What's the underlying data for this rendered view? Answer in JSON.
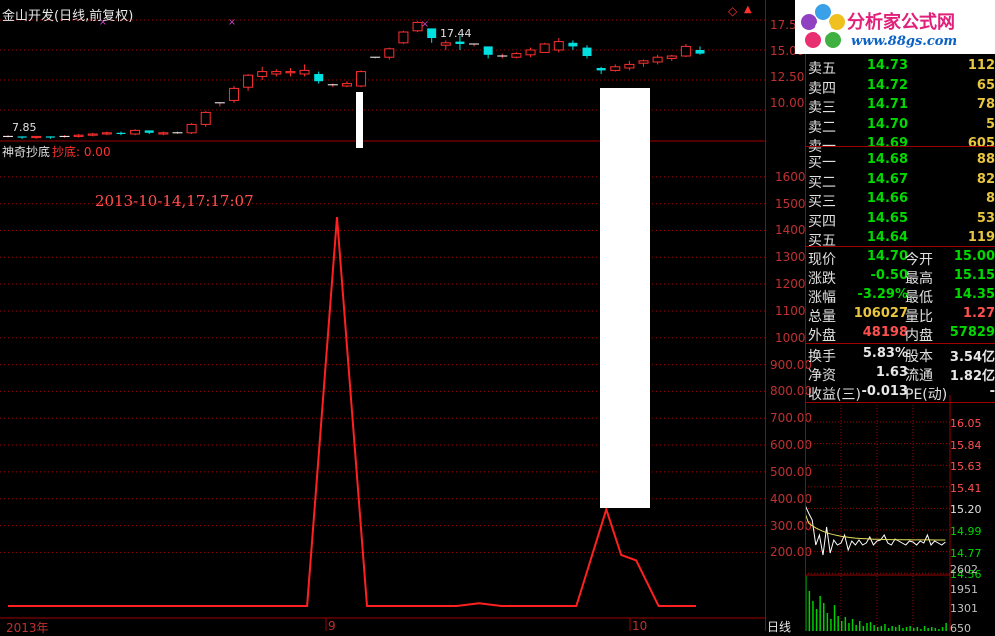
{
  "header": {
    "title": "金山开发(日线,前复权)",
    "indicator_name": "神奇抄底",
    "indicator_label": "抄底: 0.00",
    "timestamp": "2013-10-14,17:17:07",
    "corner_icon": "diamond-icon"
  },
  "price_panel": {
    "ticks": [
      "17.50",
      "15.00",
      "12.50",
      "10.00"
    ],
    "high_label": "17.44",
    "low_label": "7.85"
  },
  "indicator_panel": {
    "ticks": [
      "1600",
      "1500",
      "1400",
      "1300",
      "1200",
      "1100",
      "1000",
      "900.00",
      "800.00",
      "700.00",
      "600.00",
      "500.00",
      "400.00",
      "300.00",
      "200.00"
    ]
  },
  "bottom_axis": {
    "labels": [
      "2013年",
      "9",
      "10"
    ],
    "period": "日线"
  },
  "logo": {
    "title": "分析家公式网",
    "url": "www.88gs.com"
  },
  "quotes": {
    "asks": [
      {
        "label": "卖五",
        "price": "14.73",
        "volume": "112"
      },
      {
        "label": "卖四",
        "price": "14.72",
        "volume": "65"
      },
      {
        "label": "卖三",
        "price": "14.71",
        "volume": "78"
      },
      {
        "label": "卖二",
        "price": "14.70",
        "volume": "5"
      },
      {
        "label": "卖一",
        "price": "14.69",
        "volume": "605"
      }
    ],
    "bids": [
      {
        "label": "买一",
        "price": "14.68",
        "volume": "88"
      },
      {
        "label": "买二",
        "price": "14.67",
        "volume": "82"
      },
      {
        "label": "买三",
        "price": "14.66",
        "volume": "8"
      },
      {
        "label": "买四",
        "price": "14.65",
        "volume": "53"
      },
      {
        "label": "买五",
        "price": "14.64",
        "volume": "119"
      }
    ]
  },
  "stats": [
    {
      "l1": "现价",
      "v1": "14.70",
      "c1": "#00d800",
      "l2": "今开",
      "v2": "15.00",
      "c2": "#00d800"
    },
    {
      "l1": "涨跌",
      "v1": "-0.50",
      "c1": "#00d800",
      "l2": "最高",
      "v2": "15.15",
      "c2": "#00d800"
    },
    {
      "l1": "涨幅",
      "v1": "-3.29%",
      "c1": "#00d800",
      "l2": "最低",
      "v2": "14.35",
      "c2": "#00d800"
    },
    {
      "l1": "总量",
      "v1": "106027",
      "c1": "#e8c640",
      "l2": "量比",
      "v2": "1.27",
      "c2": "#ff5050"
    },
    {
      "l1": "外盘",
      "v1": "48198",
      "c1": "#ff5050",
      "l2": "内盘",
      "v2": "57829",
      "c2": "#00d800"
    },
    {
      "l1": "换手",
      "v1": "5.83%",
      "c1": "#e8e8e8",
      "l2": "股本",
      "v2": "3.54亿",
      "c2": "#e8e8e8"
    },
    {
      "l1": "净资",
      "v1": "1.63",
      "c1": "#e8e8e8",
      "l2": "流通",
      "v2": "1.82亿",
      "c2": "#e8e8e8"
    },
    {
      "l1": "收益(三)",
      "v1": "-0.013",
      "c1": "#e8e8e8",
      "l2": "PE(动)",
      "v2": "-",
      "c2": "#e8e8e8"
    }
  ],
  "intraday": {
    "price_ticks": [
      "16.05",
      "15.84",
      "15.63",
      "15.41",
      "15.20",
      "14.99",
      "14.77",
      "14.56"
    ],
    "volume_ticks": [
      "2602",
      "1951",
      "1301",
      "650"
    ]
  },
  "chart_data": {
    "type": "line",
    "title": "神奇抄底",
    "series": [
      {
        "name": "抄底",
        "x": [
          0,
          5,
          10,
          15,
          20,
          22,
          24,
          26,
          30,
          34,
          36,
          38,
          40,
          43
        ],
        "values": [
          0,
          0,
          0,
          0,
          0,
          1450,
          0,
          0,
          10,
          0,
          0,
          0,
          360,
          0
        ]
      }
    ],
    "candles": [
      [
        7.8,
        7.9,
        7.7,
        7.8
      ],
      [
        7.8,
        7.8,
        7.6,
        7.7
      ],
      [
        7.7,
        7.8,
        7.6,
        7.8
      ],
      [
        7.8,
        7.8,
        7.6,
        7.7
      ],
      [
        7.8,
        7.9,
        7.7,
        7.8
      ],
      [
        7.8,
        8.0,
        7.7,
        7.9
      ],
      [
        7.9,
        8.1,
        7.8,
        8.0
      ],
      [
        8.0,
        8.2,
        7.9,
        8.1
      ],
      [
        8.1,
        8.2,
        7.9,
        8.0
      ],
      [
        8.0,
        8.4,
        7.9,
        8.3
      ],
      [
        8.3,
        8.2,
        8.0,
        8.1
      ],
      [
        8.0,
        8.2,
        7.9,
        8.1
      ],
      [
        8.1,
        8.2,
        8.0,
        8.1
      ],
      [
        8.1,
        8.9,
        8.0,
        8.8
      ],
      [
        8.8,
        9.9,
        8.6,
        9.8
      ],
      [
        10.6,
        10.6,
        10.3,
        10.6
      ],
      [
        10.8,
        12.0,
        10.6,
        11.8
      ],
      [
        11.9,
        13.0,
        11.6,
        12.9
      ],
      [
        12.8,
        13.6,
        12.5,
        13.2
      ],
      [
        13.0,
        13.4,
        12.8,
        13.2
      ],
      [
        13.1,
        13.5,
        12.8,
        13.2
      ],
      [
        13.0,
        13.8,
        12.8,
        13.3
      ],
      [
        13.0,
        13.2,
        12.2,
        12.4
      ],
      [
        12.1,
        12.2,
        11.9,
        12.1
      ],
      [
        12.0,
        12.4,
        11.9,
        12.2
      ],
      [
        12.0,
        13.3,
        11.9,
        13.2
      ],
      [
        14.4,
        14.4,
        14.3,
        14.4
      ],
      [
        14.4,
        15.2,
        14.2,
        15.1
      ],
      [
        15.6,
        16.6,
        15.5,
        16.5
      ],
      [
        16.6,
        17.4,
        16.5,
        17.3
      ],
      [
        16.8,
        16.5,
        15.6,
        16.0
      ],
      [
        15.4,
        15.8,
        15.0,
        15.6
      ],
      [
        15.7,
        16.2,
        15.0,
        15.5
      ],
      [
        15.5,
        15.5,
        15.3,
        15.5
      ],
      [
        15.3,
        15.2,
        14.3,
        14.6
      ],
      [
        14.5,
        14.7,
        14.3,
        14.5
      ],
      [
        14.4,
        14.8,
        14.3,
        14.7
      ],
      [
        14.6,
        15.2,
        14.4,
        15.0
      ],
      [
        14.8,
        15.6,
        14.8,
        15.5
      ],
      [
        15.0,
        16.0,
        14.8,
        15.7
      ],
      [
        15.6,
        15.8,
        15.0,
        15.3
      ],
      [
        15.2,
        15.4,
        14.3,
        14.5
      ],
      [
        13.5,
        13.6,
        13.0,
        13.3
      ],
      [
        13.3,
        13.8,
        13.2,
        13.6
      ],
      [
        13.5,
        14.1,
        13.3,
        13.8
      ],
      [
        13.9,
        14.2,
        13.6,
        14.1
      ],
      [
        14.0,
        14.6,
        13.8,
        14.4
      ],
      [
        14.3,
        14.6,
        14.1,
        14.5
      ],
      [
        14.5,
        15.5,
        14.4,
        15.3
      ],
      [
        15.0,
        15.3,
        14.6,
        14.7
      ]
    ],
    "ylim_price": [
      7.5,
      18.0
    ],
    "ylim_indicator": [
      0,
      1700
    ]
  }
}
